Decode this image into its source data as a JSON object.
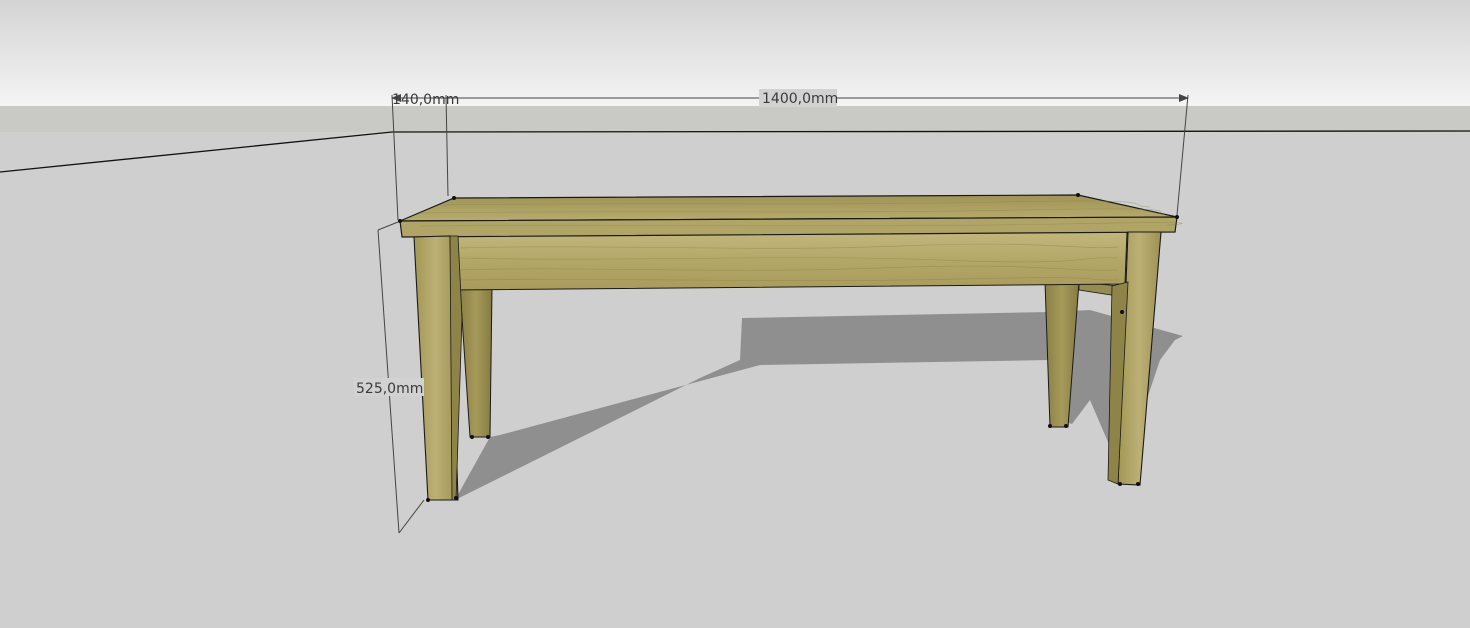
{
  "model": {
    "object": "bench",
    "dimensions": {
      "depth_label": "140,0mm",
      "length_label": "1400,0mm",
      "height_label": "525,0mm"
    }
  },
  "colors": {
    "sky_top": "#d6d6d6",
    "sky_bottom": "#f3f3f3",
    "ground": "#cfcfcf",
    "horizon_band": "#c9c9c7",
    "shadow": "#8e8e8e",
    "wood_light": "#b9ad73",
    "wood_mid": "#a69a5c",
    "wood_dark": "#8e8248",
    "edge": "#1a1a1a",
    "dimension_line": "#444444"
  }
}
